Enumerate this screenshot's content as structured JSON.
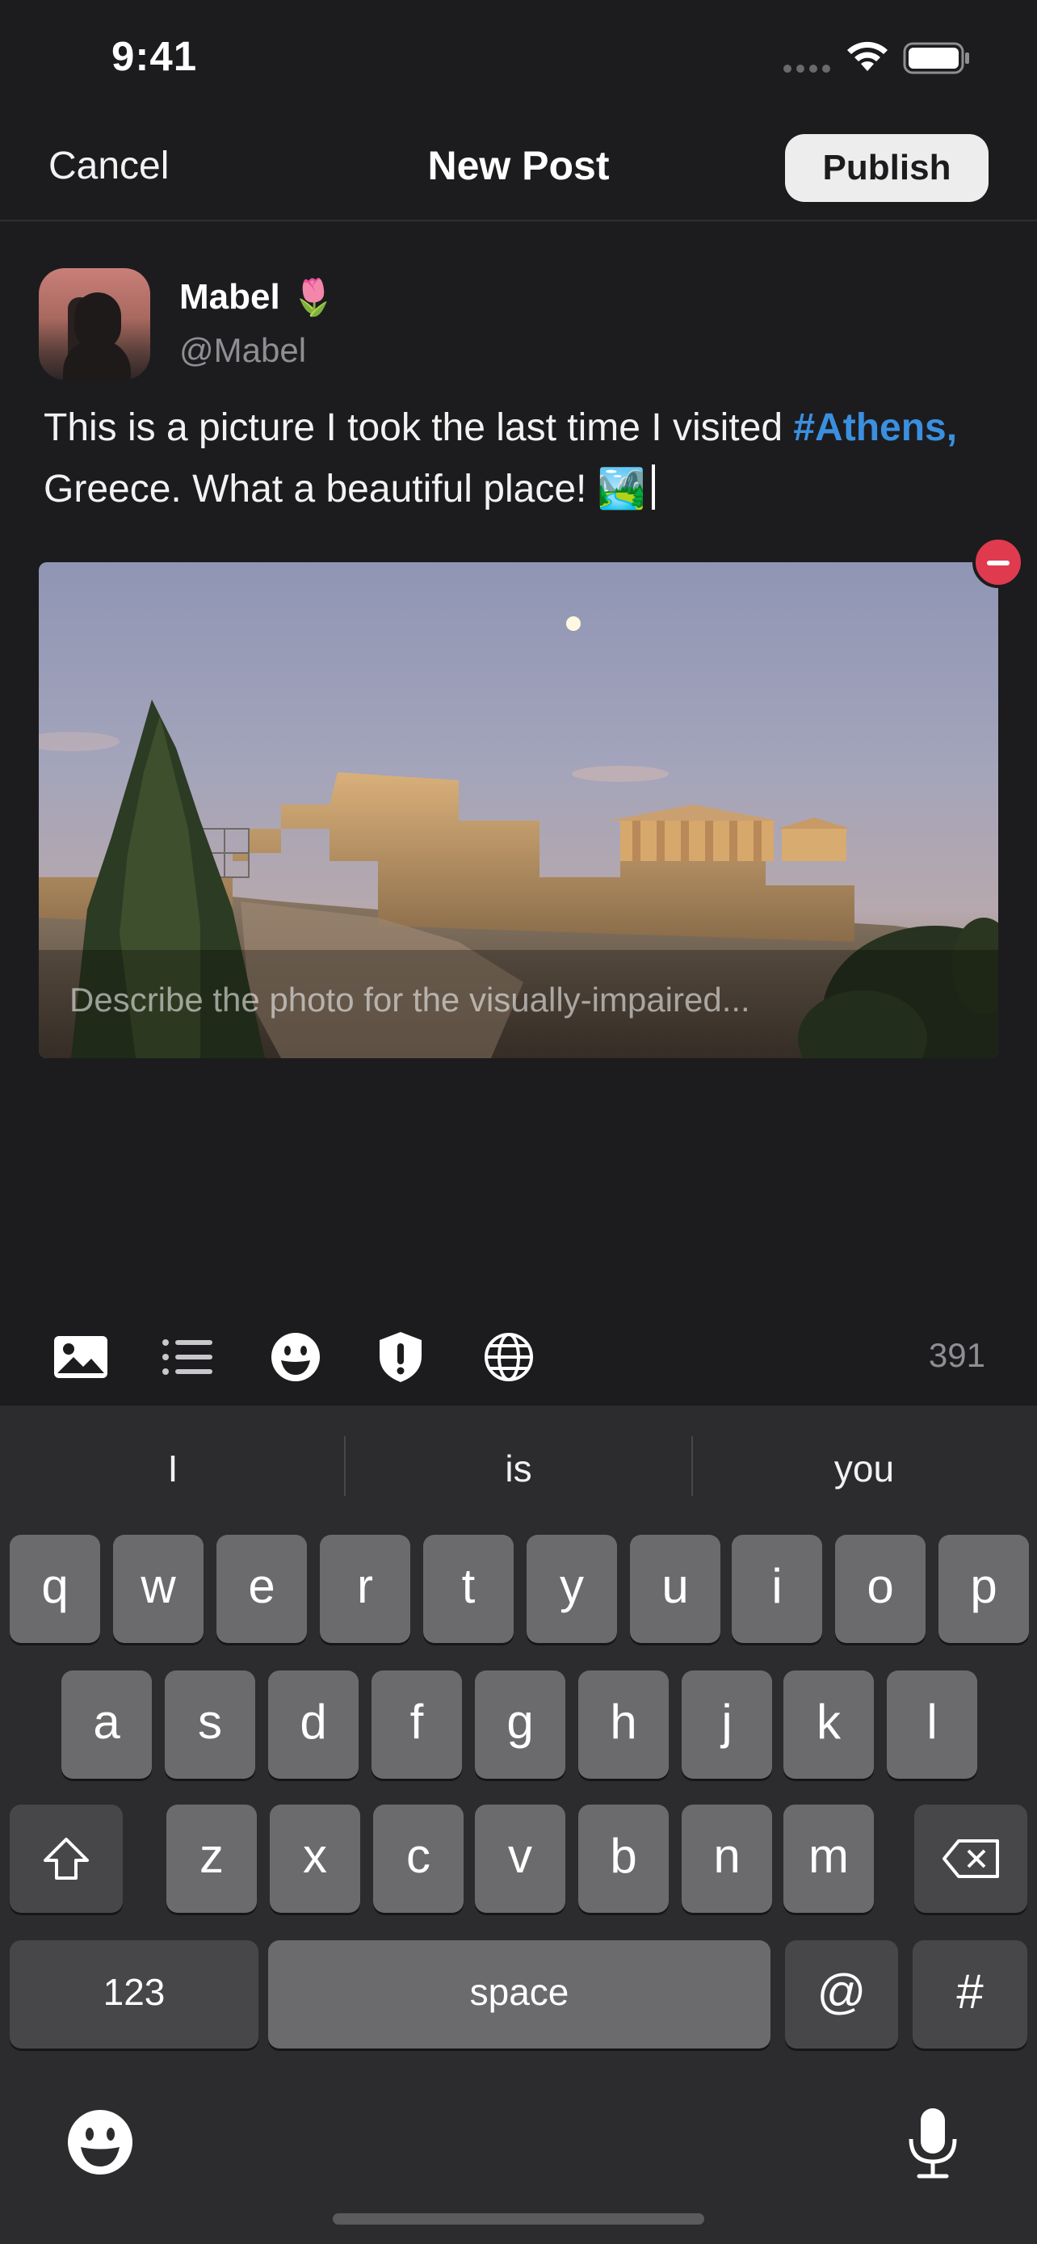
{
  "status_bar": {
    "time": "9:41",
    "icons": [
      "signal-icon",
      "wifi-icon",
      "battery-icon"
    ]
  },
  "nav": {
    "cancel_label": "Cancel",
    "title": "New Post",
    "publish_label": "Publish"
  },
  "author": {
    "display_name": "Mabel",
    "name_emoji": "🌷",
    "handle": "@Mabel"
  },
  "post": {
    "text_before": "This is a picture I took the last time I visited ",
    "hashtag": "#Athens,",
    "text_after": " Greece. What a beautiful place! ",
    "trailing_emoji": "🏞️"
  },
  "attachment": {
    "alt_placeholder": "Describe the photo for the visually-impaired...",
    "remove_icon": "minus-circle-icon"
  },
  "toolbar": {
    "icons": [
      "image-icon",
      "list-icon",
      "emoji-icon",
      "content-warning-icon",
      "globe-icon"
    ],
    "char_count": "391"
  },
  "keyboard": {
    "suggestions": [
      "I",
      "is",
      "you"
    ],
    "row1": [
      "q",
      "w",
      "e",
      "r",
      "t",
      "y",
      "u",
      "i",
      "o",
      "p"
    ],
    "row2": [
      "a",
      "s",
      "d",
      "f",
      "g",
      "h",
      "j",
      "k",
      "l"
    ],
    "row3": [
      "z",
      "x",
      "c",
      "v",
      "b",
      "n",
      "m"
    ],
    "numbers_label": "123",
    "space_label": "space",
    "at_label": "@",
    "hash_label": "#"
  },
  "colors": {
    "accent_hashtag": "#3b8fe0",
    "remove": "#e03a4e",
    "background": "#1c1c1e"
  }
}
